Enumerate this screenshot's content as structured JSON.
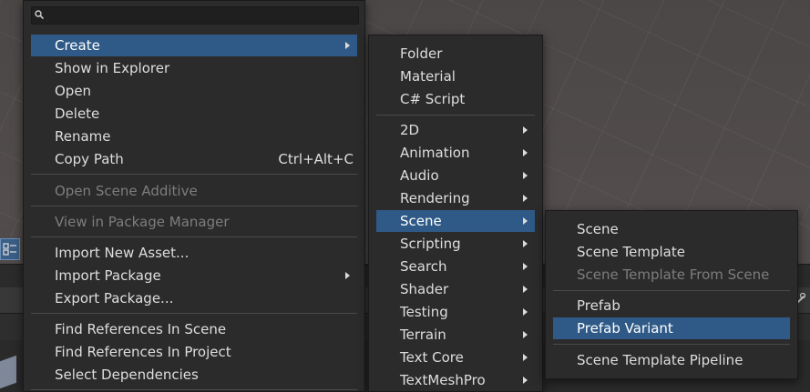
{
  "search": {
    "placeholder": "",
    "value": ""
  },
  "main_menu": {
    "create": "Create",
    "show_in_explorer": "Show in Explorer",
    "open": "Open",
    "delete": "Delete",
    "rename": "Rename",
    "copy_path": "Copy Path",
    "copy_path_shortcut": "Ctrl+Alt+C",
    "open_scene_additive": "Open Scene Additive",
    "view_in_package_manager": "View in Package Manager",
    "import_new_asset": "Import New Asset...",
    "import_package": "Import Package",
    "export_package": "Export Package...",
    "find_refs_scene": "Find References In Scene",
    "find_refs_project": "Find References In Project",
    "select_dependencies": "Select Dependencies"
  },
  "create_menu": {
    "folder": "Folder",
    "material": "Material",
    "csharp_script": "C# Script",
    "items": [
      "2D",
      "Animation",
      "Audio",
      "Rendering",
      "Scene",
      "Scripting",
      "Search",
      "Shader",
      "Testing",
      "Terrain",
      "Text Core",
      "TextMeshPro"
    ]
  },
  "scene_menu": {
    "scene": "Scene",
    "scene_template": "Scene Template",
    "scene_template_from_scene": "Scene Template From Scene",
    "prefab": "Prefab",
    "prefab_variant": "Prefab Variant",
    "scene_template_pipeline": "Scene Template Pipeline"
  },
  "colors": {
    "selection": "#2f5a87",
    "menu_bg": "#2b2b2b",
    "disabled_text": "#7d7d7d"
  },
  "icons": [
    "search-icon",
    "submenu-arrow-icon",
    "layout-icon",
    "lock-icon"
  ]
}
